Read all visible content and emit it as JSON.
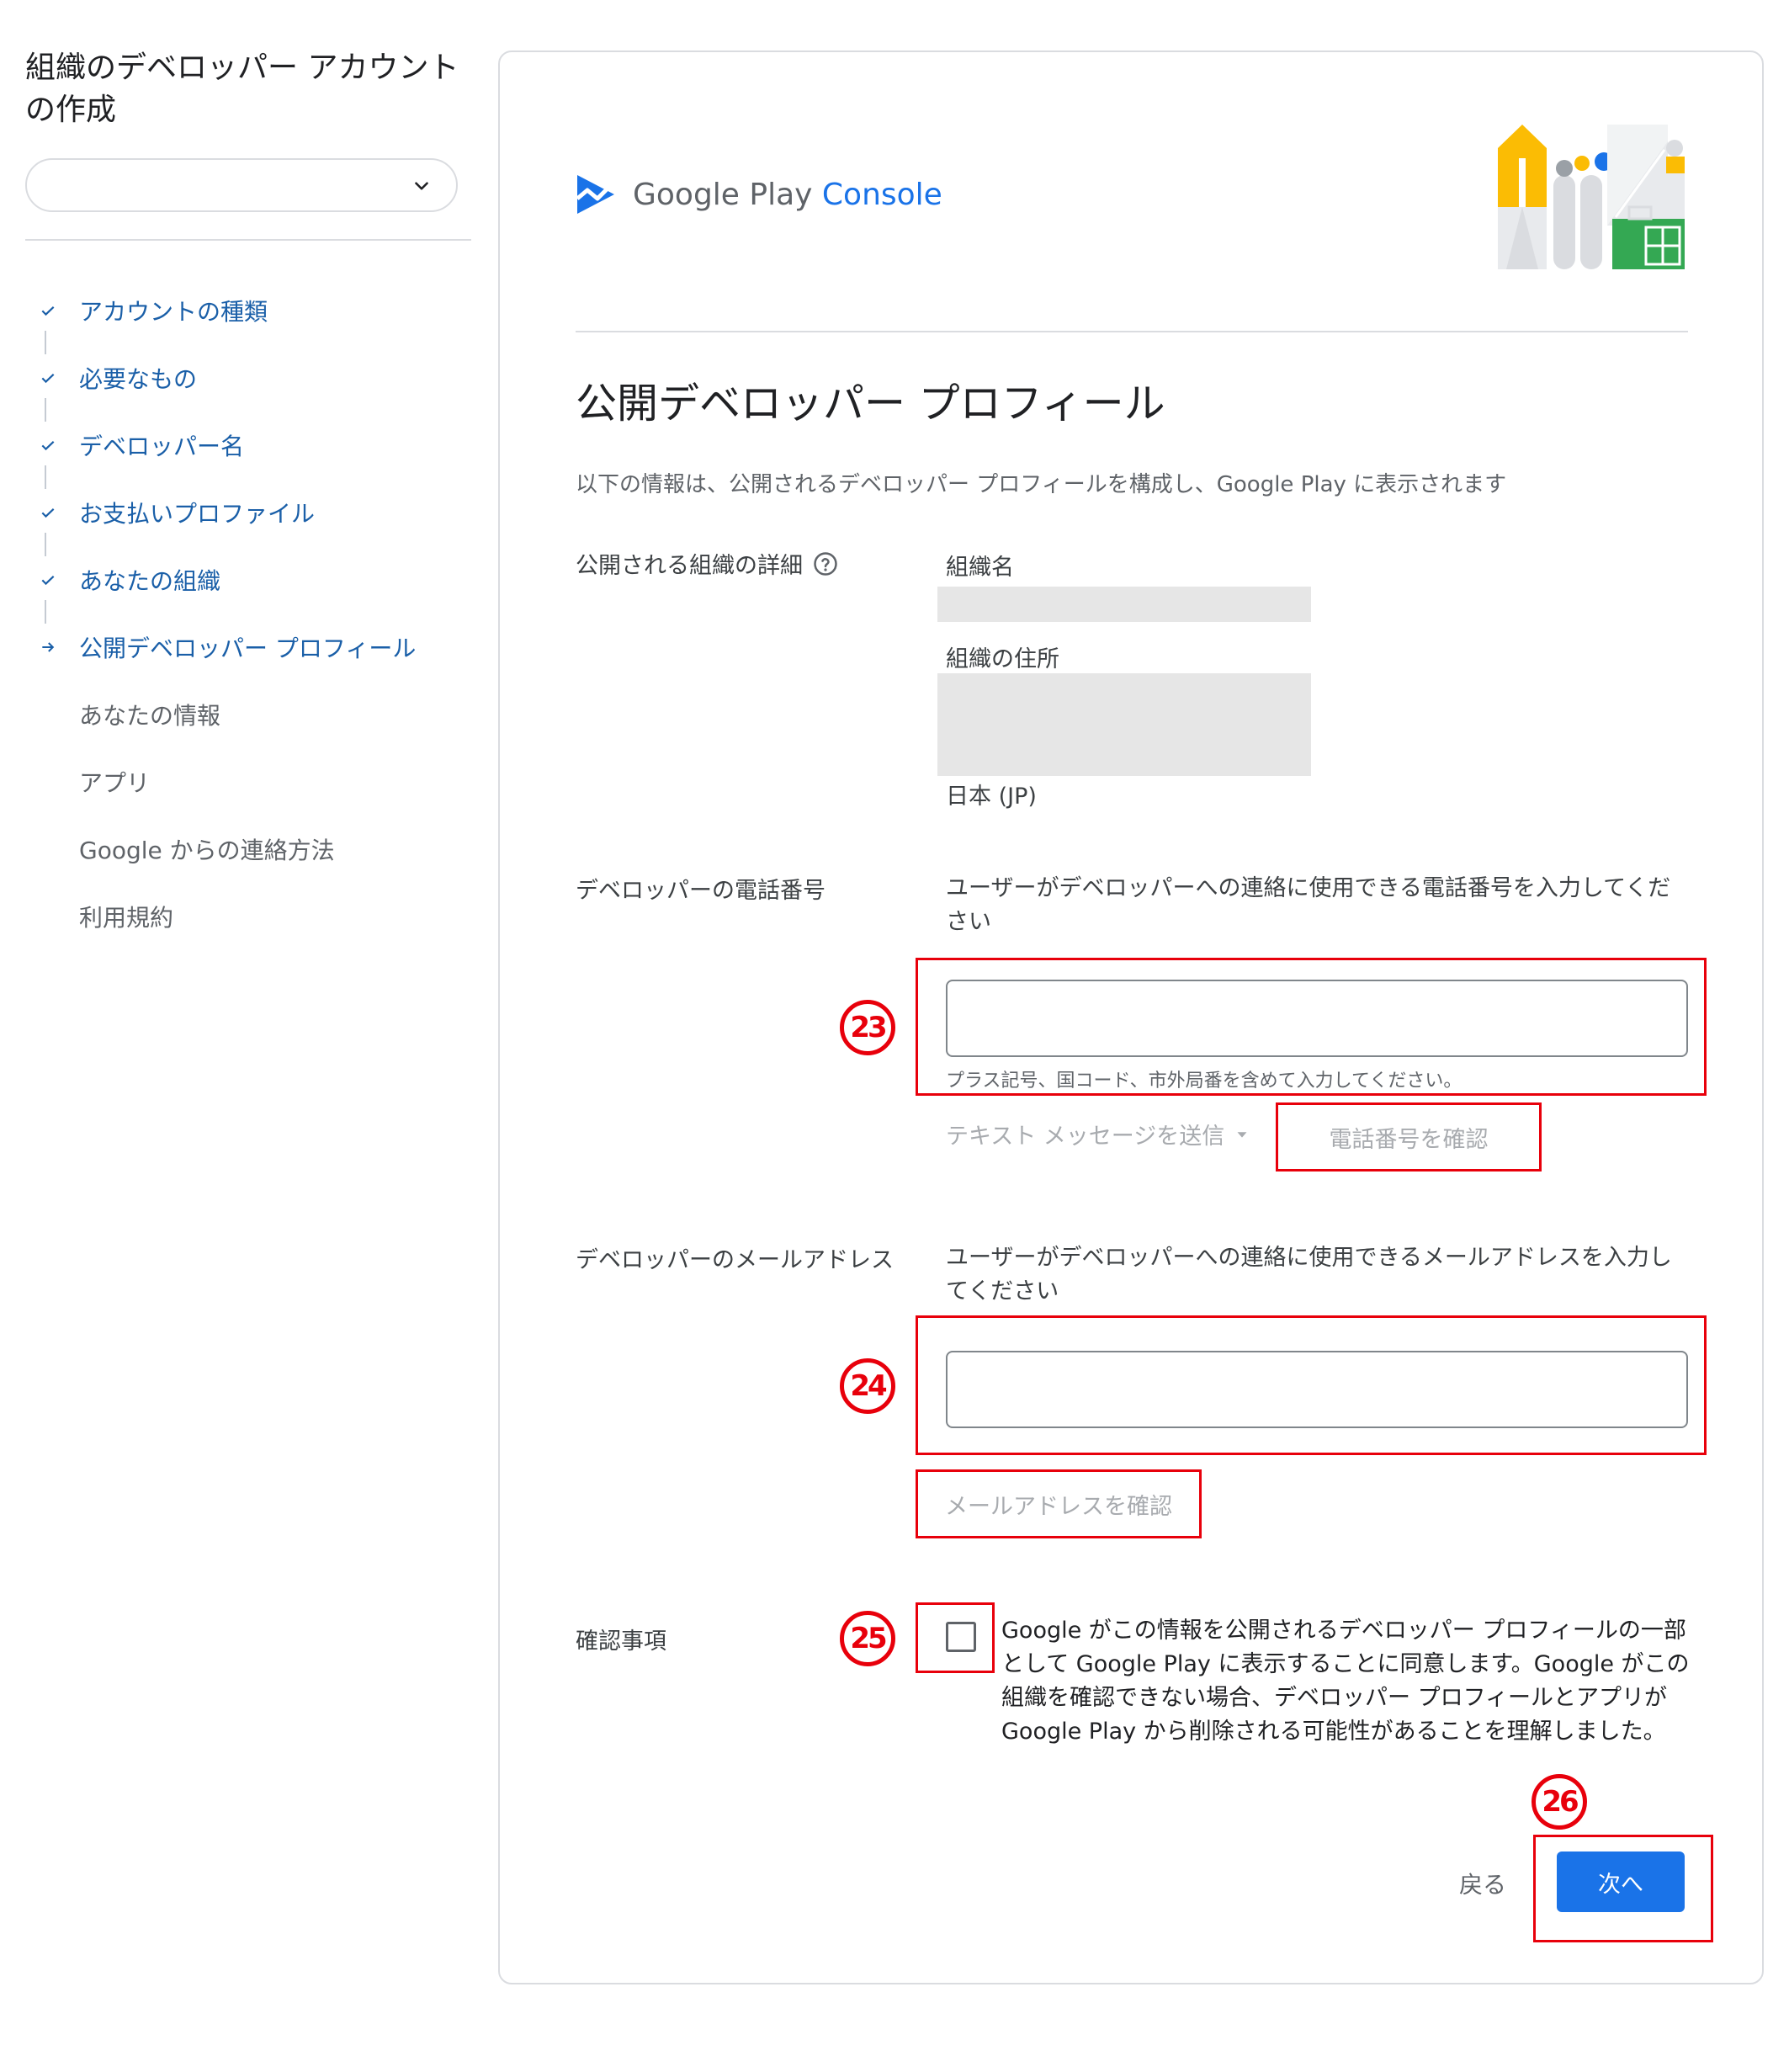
{
  "sidebar": {
    "title": "組織のデベロッパー アカウントの作成",
    "account_select": {
      "value": ""
    },
    "steps": [
      {
        "label": "アカウントの種類",
        "state": "done"
      },
      {
        "label": "必要なもの",
        "state": "done"
      },
      {
        "label": "デベロッパー名",
        "state": "done"
      },
      {
        "label": "お支払いプロファイル",
        "state": "done"
      },
      {
        "label": "あなたの組織",
        "state": "done"
      },
      {
        "label": "公開デベロッパー プロフィール",
        "state": "current"
      },
      {
        "label": "あなたの情報",
        "state": "todo"
      },
      {
        "label": "アプリ",
        "state": "todo"
      },
      {
        "label": "Google からの連絡方法",
        "state": "todo"
      },
      {
        "label": "利用規約",
        "state": "todo"
      }
    ]
  },
  "brand": {
    "name": "Google Play",
    "product": "Console"
  },
  "page": {
    "title": "公開デベロッパー プロフィール",
    "intro": "以下の情報は、公開されるデベロッパー プロフィールを構成し、Google Play に表示されます"
  },
  "org_details": {
    "label": "公開される組織の詳細",
    "name_label": "組織名",
    "address_label": "組織の住所",
    "country": "日本 (JP)"
  },
  "phone": {
    "label": "デベロッパーの電話番号",
    "description": "ユーザーがデベロッパーへの連絡に使用できる電話番号を入力してください",
    "value": "",
    "hint": "プラス記号、国コード、市外局番を含めて入力してください。",
    "method_select": "テキスト メッセージを送信",
    "verify_button": "電話番号を確認"
  },
  "email": {
    "label": "デベロッパーのメールアドレス",
    "description": "ユーザーがデベロッパーへの連絡に使用できるメールアドレスを入力してください",
    "value": "",
    "verify_button": "メールアドレスを確認"
  },
  "confirmation": {
    "label": "確認事項",
    "checked": false,
    "text": "Google がこの情報を公開されるデベロッパー プロフィールの一部として Google Play に表示することに同意します。Google がこの組織を確認できない場合、デベロッパー プロフィールとアプリが Google Play から削除される可能性があることを理解しました。"
  },
  "footer": {
    "back_label": "戻る",
    "next_label": "次へ"
  },
  "annotations": {
    "a23": "23",
    "a24": "24",
    "a25": "25",
    "a26": "26"
  },
  "colors": {
    "accent": "#1a73e8",
    "step_link": "#1a5fa8",
    "annotation_red": "#e8000b"
  }
}
